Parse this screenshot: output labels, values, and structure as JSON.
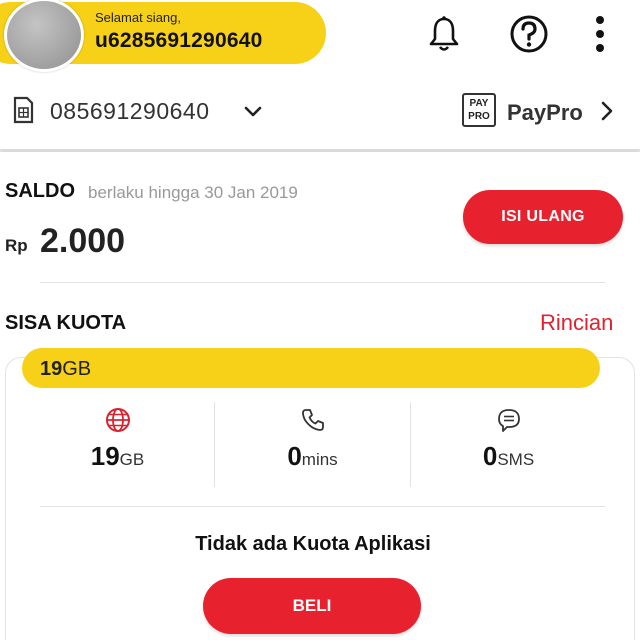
{
  "header": {
    "greeting": "Selamat siang,",
    "username": "u6285691290640",
    "icons": [
      "bell-icon",
      "help-icon",
      "more-vertical-icon"
    ]
  },
  "account": {
    "phone_number": "085691290640",
    "paypro_logo_line1": "PAY",
    "paypro_logo_line2": "PRO",
    "paypro_label": "PayPro"
  },
  "saldo": {
    "title": "SALDO",
    "expiry": "berlaku hingga 30 Jan 2019",
    "currency": "Rp",
    "amount": "2.000",
    "topup_label": "ISI ULANG"
  },
  "kuota": {
    "title": "SISA KUOTA",
    "detail_link": "Rincian",
    "total_value": "19",
    "total_unit": "GB",
    "stats": [
      {
        "icon": "globe-icon",
        "value": "19",
        "unit": "GB"
      },
      {
        "icon": "phone-icon",
        "value": "0",
        "unit": "mins"
      },
      {
        "icon": "chat-icon",
        "value": "0",
        "unit": "SMS"
      }
    ],
    "no_app_quota": "Tidak ada Kuota Aplikasi",
    "buy_label": "BELI"
  },
  "colors": {
    "brand_yellow": "#f7d117",
    "accent_red": "#e8212e",
    "link_red": "#e02230"
  }
}
